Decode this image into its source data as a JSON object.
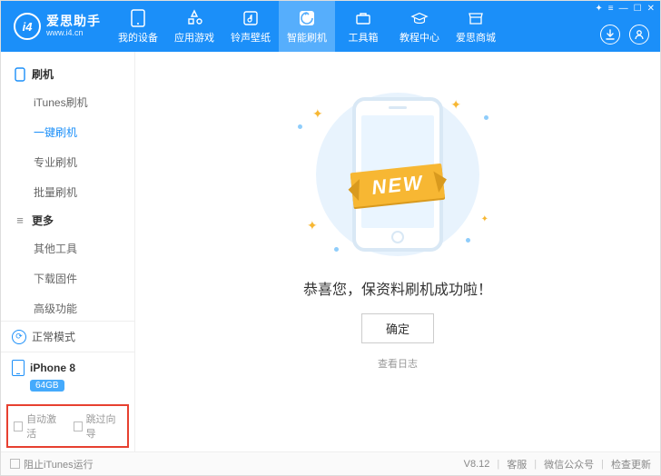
{
  "brand": {
    "name": "爱思助手",
    "url": "www.i4.cn",
    "logo_text": "i4"
  },
  "nav": [
    {
      "label": "我的设备"
    },
    {
      "label": "应用游戏"
    },
    {
      "label": "铃声壁纸"
    },
    {
      "label": "智能刷机"
    },
    {
      "label": "工具箱"
    },
    {
      "label": "教程中心"
    },
    {
      "label": "爱思商城"
    }
  ],
  "nav_active_index": 3,
  "sidebar": {
    "group1": {
      "title": "刷机",
      "items": [
        "iTunes刷机",
        "一键刷机",
        "专业刷机",
        "批量刷机"
      ],
      "active_index": 1
    },
    "group2": {
      "title": "更多",
      "items": [
        "其他工具",
        "下载固件",
        "高级功能"
      ]
    }
  },
  "mode": {
    "label": "正常模式"
  },
  "device": {
    "name": "iPhone 8",
    "storage": "64GB"
  },
  "options": {
    "auto_activate": "自动激活",
    "skip_guide": "跳过向导"
  },
  "main": {
    "ribbon": "NEW",
    "success": "恭喜您，保资料刷机成功啦！",
    "ok": "确定",
    "viewlog": "查看日志"
  },
  "footer": {
    "block_itunes": "阻止iTunes运行",
    "version": "V8.12",
    "links": [
      "客服",
      "微信公众号",
      "检查更新"
    ]
  }
}
